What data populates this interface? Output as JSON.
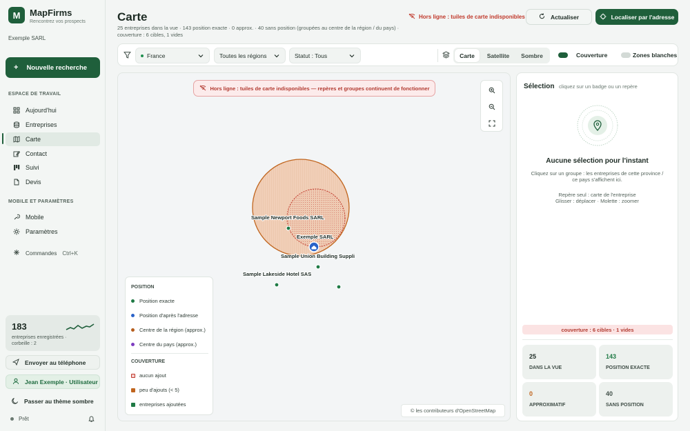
{
  "app": {
    "logo_letter": "M",
    "name": "MapFirms",
    "tagline": "Rencontrez vos prospects",
    "company": "Exemple SARL"
  },
  "sidebar": {
    "new_search_label": "Nouvelle recherche",
    "workspace_title": "ESPACE DE TRAVAIL",
    "items": [
      {
        "label": "Aujourd'hui",
        "icon": "grid-icon"
      },
      {
        "label": "Entreprises",
        "icon": "database-icon"
      },
      {
        "label": "Carte",
        "icon": "map-icon"
      },
      {
        "label": "Contact",
        "icon": "edit-icon"
      },
      {
        "label": "Suivi",
        "icon": "kanban-icon"
      },
      {
        "label": "Devis",
        "icon": "document-icon"
      }
    ],
    "mobile_title": "MOBILE ET PARAMÈTRES",
    "mobile_items": [
      {
        "label": "Mobile",
        "icon": "mobile-icon"
      },
      {
        "label": "Paramètres",
        "icon": "gear-icon"
      }
    ],
    "commands_label": "Commandes",
    "commands_shortcut": "Ctrl+K",
    "stats_count": "183",
    "stats_text": "entreprises enregistrées · corbeille : 2",
    "send_phone_label": "Envoyer au téléphone",
    "user_label": "Jean Exemple · Utilisateur",
    "theme_label": "Passer au thème sombre",
    "status_label": "Prêt"
  },
  "header": {
    "title": "Carte",
    "subtitle": "25 entreprises dans la vue · 143 position exacte · 0 approx. · 40 sans position (groupées au centre de la région / du pays) · couverture : 6 cibles, 1 vides",
    "offline_notice": "Hors ligne : tuiles de carte indisponibles",
    "refresh_label": "Actualiser",
    "locate_label": "Localiser par l'adresse"
  },
  "toolbar": {
    "country": "France",
    "region": "Toutes les régions",
    "status": "Statut : Tous",
    "views": [
      "Carte",
      "Satellite",
      "Sombre"
    ],
    "active_view": "Carte",
    "coverage_label": "Couverture",
    "coverage_on": true,
    "white_zones_label": "Zones blanches",
    "white_zones_on": false
  },
  "map": {
    "offline_banner": "Hors ligne : tuiles de carte indisponibles — repères et groupes continuent de fonctionner",
    "markers": [
      {
        "label": "Sample Newport Foods SARL"
      },
      {
        "label": "Exemple SARL"
      },
      {
        "label": "Sample Union Building Suppli"
      },
      {
        "label": "Sample Lakeside Hotel SAS"
      }
    ],
    "attribution": "© les contributeurs d'OpenStreetMap"
  },
  "legend": {
    "position_title": "POSITION",
    "position_items": [
      {
        "label": "Position exacte",
        "color": "#1f7a45"
      },
      {
        "label": "Position d'après l'adresse",
        "color": "#2a63c9"
      },
      {
        "label": "Centre de la région (approx.)",
        "color": "#b65e1e"
      },
      {
        "label": "Centre du pays (approx.)",
        "color": "#7d3cc0"
      }
    ],
    "coverage_title": "COUVERTURE",
    "coverage_items": [
      {
        "label": "aucun ajout",
        "color": "#f3cfcf"
      },
      {
        "label": "peu d'ajouts (< 5)",
        "color": "#c0651e"
      },
      {
        "label": "entreprises ajoutées",
        "color": "#1f7a45"
      }
    ]
  },
  "panel": {
    "title": "Sélection",
    "hint": "cliquez sur un badge ou un repère",
    "empty_title": "Aucune sélection pour l'instant",
    "empty_text": "Cliquez sur un groupe : les entreprises de cette province / ce pays s'affichent ici.",
    "help_line1": "Repère seul : carte de l'entreprise",
    "help_line2": "Glisser : déplacer · Molette : zoomer",
    "coverage_bar": "couverture : 6 cibles · 1 vides",
    "stats": [
      {
        "value": "25",
        "label": "DANS LA VUE",
        "color": "#1d2b24"
      },
      {
        "value": "143",
        "label": "POSITION EXACTE",
        "color": "#1f7a45"
      },
      {
        "value": "0",
        "label": "APPROXIMATIF",
        "color": "#c0651e"
      },
      {
        "value": "40",
        "label": "SANS POSITION",
        "color": "#44524b"
      }
    ]
  }
}
